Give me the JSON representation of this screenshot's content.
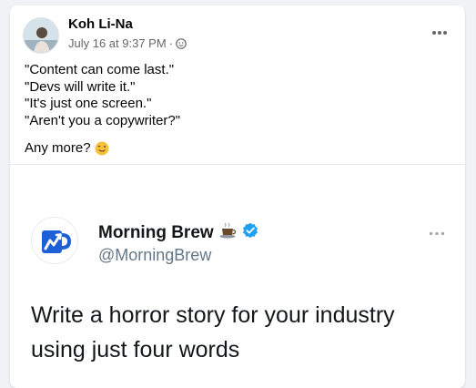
{
  "post": {
    "author_name": "Koh Li-Na",
    "timestamp": "July 16 at 9:37 PM",
    "separator": "·",
    "privacy_icon": "friends-icon",
    "more_icon": "more-dots-icon",
    "lines": [
      "\"Content can come last.\"",
      "\"Devs will write it.\"",
      "\"It's just one screen.\"",
      "\"Aren't you a copywriter?\""
    ],
    "closing": "Any more?",
    "closing_emoji": "winking-face-tongue-icon"
  },
  "tweet": {
    "display_name": "Morning Brew",
    "name_emoji": "coffee-icon",
    "verified_icon": "verified-badge-icon",
    "handle": "@MorningBrew",
    "text": "Write a horror story for your industry using just four words",
    "logo_icon": "morning-brew-mug-logo",
    "more_icon": "more-dots-icon",
    "brand_color": "#1d5fd6",
    "verified_color": "#1da1f2"
  },
  "colors": {
    "page_bg": "#f0f2f5",
    "card_bg": "#ffffff",
    "text_primary": "#050505",
    "text_secondary": "#65676b"
  }
}
